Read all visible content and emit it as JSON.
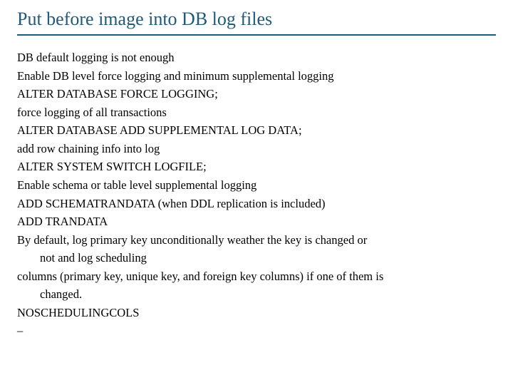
{
  "title": "Put before image into DB log files",
  "lines": [
    {
      "text": "DB default logging is not enough",
      "indent": false
    },
    {
      "text": "Enable DB level force logging and minimum supplemental logging",
      "indent": false
    },
    {
      "text": "ALTER DATABASE FORCE LOGGING;",
      "indent": false
    },
    {
      "text": "force logging of all transactions",
      "indent": false
    },
    {
      "text": "ALTER DATABASE ADD SUPPLEMENTAL LOG DATA;",
      "indent": false
    },
    {
      "text": "add row chaining info into log",
      "indent": false
    },
    {
      "text": "ALTER SYSTEM SWITCH LOGFILE;",
      "indent": false
    },
    {
      "text": "Enable schema or table level supplemental logging",
      "indent": false
    },
    {
      "text": "ADD SCHEMATRANDATA (when DDL replication is included)",
      "indent": false
    },
    {
      "text": "ADD TRANDATA",
      "indent": false
    },
    {
      "text": "By default, log primary key unconditionally weather the key is changed or",
      "indent": false
    },
    {
      "text": "not and log scheduling",
      "indent": true
    },
    {
      "text": "columns (primary key, unique key, and foreign key columns) if one of them is",
      "indent": false
    },
    {
      "text": "changed.",
      "indent": true
    },
    {
      "text": "NOSCHEDULINGCOLS",
      "indent": false
    },
    {
      "text": "–",
      "indent": false
    }
  ]
}
